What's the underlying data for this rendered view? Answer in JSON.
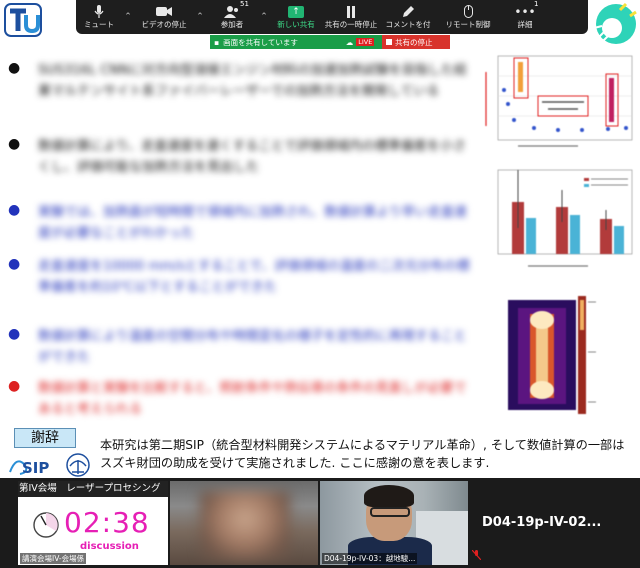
{
  "toolbar": {
    "mute": "ミュート",
    "video_stop": "ビデオの停止",
    "participants": "参加者",
    "participants_count": "51",
    "new_share": "新しい共有",
    "pause_share": "共有の一時停止",
    "annotate": "コメントを付",
    "remote_control": "リモート制御",
    "more": "詳細",
    "more_badge": "1"
  },
  "share_banner": {
    "sharing_text": "画面を共有しています",
    "live": "LIVE",
    "stop_share": "共有の停止"
  },
  "slide": {
    "bullets": [
      {
        "color": "#111111",
        "text": "SUS316L CNNに対方向型溶接エンジン材料の加速加熱試験を目指した結果マルテンサイト系ファイバーレーザーでの加熱方法を開発している"
      },
      {
        "color": "#111111",
        "text": "数値計算により、走査速度を速くすることで評価領域内の標準偏差を小さくし、評価可能な加熱方法を見出した"
      },
      {
        "color": "#2233bb",
        "text": "実験では、加熱面が短時間で領域内に加熱され、数値計算より早い走査速度が必要なことがわかった"
      },
      {
        "color": "#2233bb",
        "text": "走査速度を10000 mm/sとすることで、評価領域の温度の二次元分布の標準偏差を約10℃以下とすることができた"
      },
      {
        "color": "#2233bb",
        "text": "数値計算により温度の空間分布や時間変化の様子を定性的に再現することができた"
      },
      {
        "color": "#dd2222",
        "text": "数値計算と実験を比較すると、照射条件や熱伝導の条件の見直しが必要であると考えられる"
      }
    ],
    "ack_label": "謝辞",
    "ack_text": "本研究は第二期SIP（統合型材料開発システムによるマテリアル革命）, そして数値計算の一部はスズキ財団の助成を受けて実施されました. ここに感謝の意を表します.",
    "sip_logo_text": "SIP"
  },
  "video_strip": {
    "timer_tile": {
      "title": "第IV会場　レーザープロセシング",
      "time": "02:38",
      "status": "discussion",
      "label": "講演会場IV-会場係"
    },
    "presenter_tile": {
      "label": "D04-19p-IV-03：越地駿..."
    },
    "name_tile": {
      "name": "D04-19p-IV-02..."
    }
  }
}
